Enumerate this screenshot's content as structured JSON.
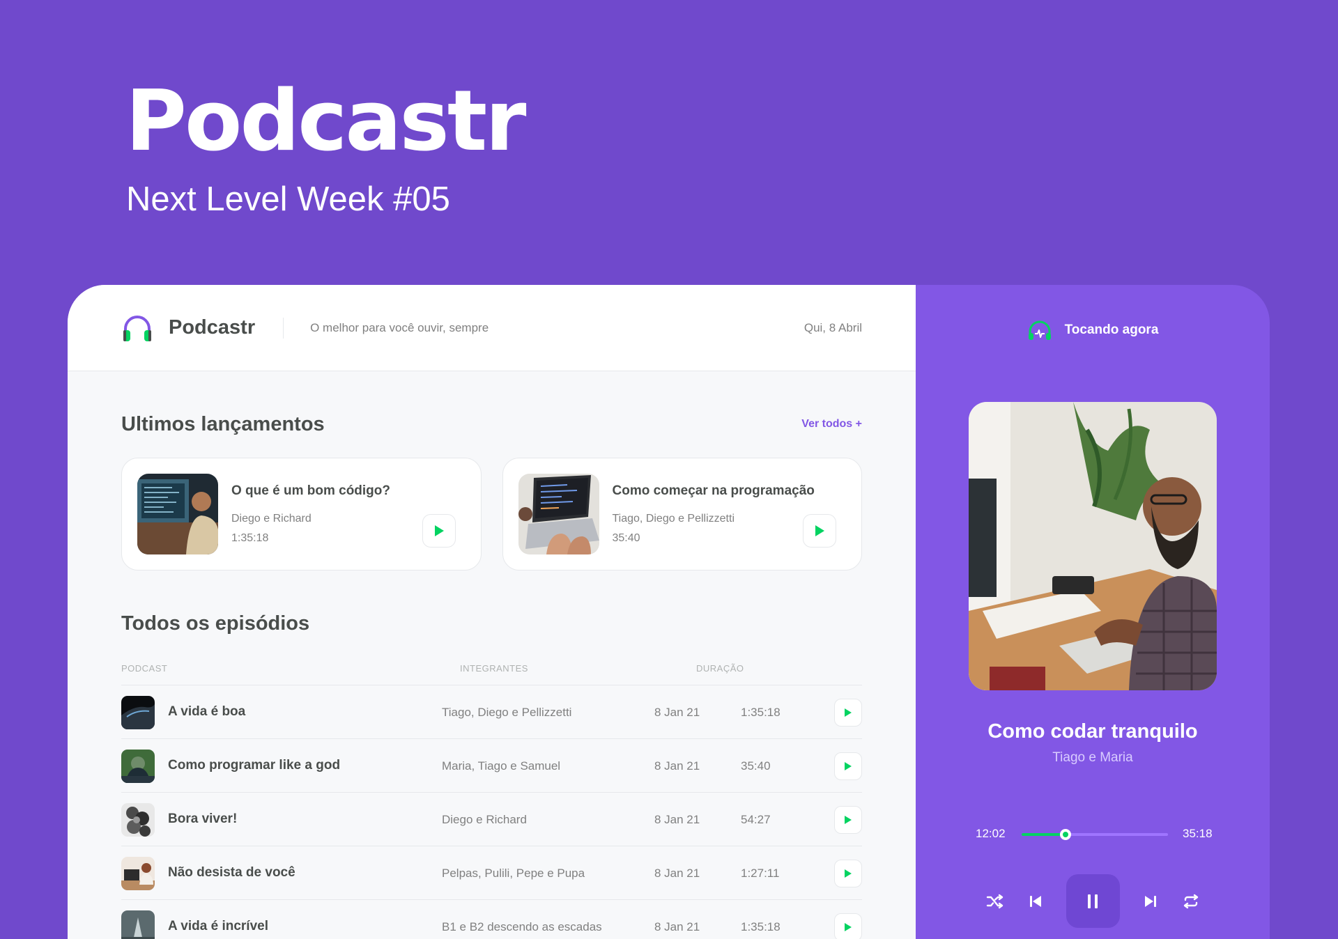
{
  "hero": {
    "title": "Podcastr",
    "subtitle": "Next Level Week #05"
  },
  "header": {
    "logo_text": "Podcastr",
    "tagline": "O melhor para você ouvir, sempre",
    "date": "Qui, 8 Abril"
  },
  "latest": {
    "title": "Ultimos lançamentos",
    "see_all": "Ver todos +",
    "episodes": [
      {
        "title": "O que é um bom código?",
        "members": "Diego e Richard",
        "duration": "1:35:18"
      },
      {
        "title": "Como começar na programação",
        "members": "Tiago, Diego e Pellizzetti",
        "duration": "35:40"
      }
    ]
  },
  "all": {
    "title": "Todos os episódios",
    "columns": {
      "podcast": "PODCAST",
      "members": "INTEGRANTES",
      "duration": "DURAÇÃO"
    },
    "episodes": [
      {
        "title": "A vida é boa",
        "members": "Tiago, Diego e Pellizzetti",
        "date": "8 Jan 21",
        "duration": "1:35:18"
      },
      {
        "title": "Como programar like a god",
        "members": "Maria, Tiago e Samuel",
        "date": "8 Jan 21",
        "duration": "35:40"
      },
      {
        "title": "Bora viver!",
        "members": "Diego e Richard",
        "date": "8 Jan 21",
        "duration": "54:27"
      },
      {
        "title": "Não desista de você",
        "members": "Pelpas, Pulili, Pepe e Pupa",
        "date": "8 Jan 21",
        "duration": "1:27:11"
      },
      {
        "title": "A vida é incrível",
        "members": "B1 e B2 descendo as escadas",
        "date": "8 Jan 21",
        "duration": "1:35:18"
      }
    ]
  },
  "player": {
    "header": "Tocando agora",
    "title": "Como codar tranquilo",
    "members": "Tiago e Maria",
    "current_time": "12:02",
    "total_time": "35:18",
    "progress": 0.3
  },
  "colors": {
    "background": "#7049cc",
    "accent": "#8257e5",
    "green": "#04d361"
  }
}
